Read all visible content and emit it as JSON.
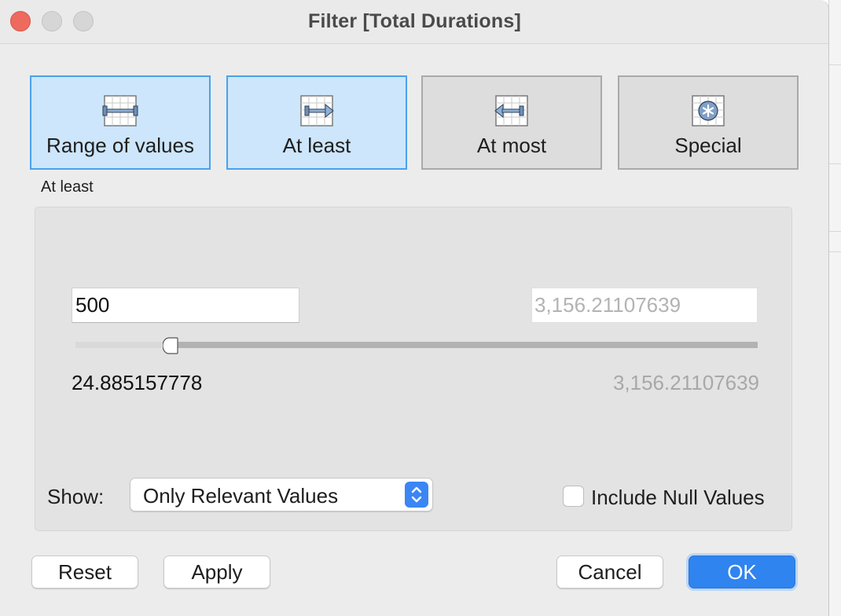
{
  "window": {
    "title": "Filter [Total Durations]"
  },
  "modes": [
    {
      "label": "Range of values",
      "icon": "range-of-values-icon",
      "selected": true
    },
    {
      "label": "At least",
      "icon": "at-least-icon",
      "selected": true
    },
    {
      "label": "At most",
      "icon": "at-most-icon",
      "selected": false
    },
    {
      "label": "Special",
      "icon": "special-icon",
      "selected": false
    }
  ],
  "filter": {
    "section_label": "At least",
    "min_value": "500",
    "max_value": "3,156.21107639",
    "range_min_label": "24.885157778",
    "range_max_label": "3,156.21107639"
  },
  "show": {
    "label": "Show:",
    "selected": "Only Relevant Values"
  },
  "include_null": {
    "label": "Include Null Values",
    "checked": false
  },
  "buttons": {
    "reset": "Reset",
    "apply": "Apply",
    "cancel": "Cancel",
    "ok": "OK"
  },
  "colors": {
    "selected_mode_bg": "#cde6fb",
    "selected_mode_border": "#49a2ec",
    "accent": "#2f84ef"
  }
}
